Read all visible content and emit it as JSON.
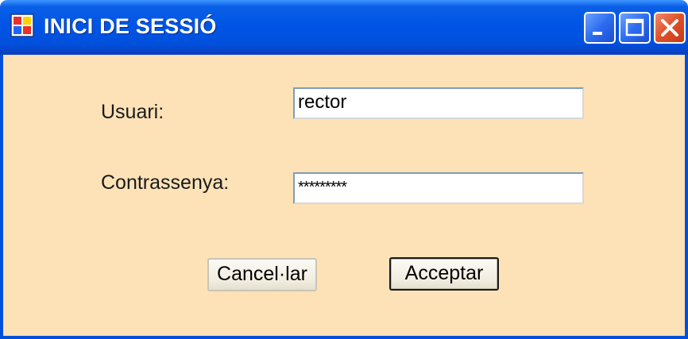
{
  "window": {
    "title": "INICI DE SESSIÓ",
    "icon": "windows-app-icon",
    "controls": [
      "minimize-icon",
      "maximize-icon",
      "close-icon"
    ]
  },
  "form": {
    "user_label": "Usuari:",
    "user_value": "rector",
    "password_label": "Contrassenya:",
    "password_value": "*********"
  },
  "buttons": {
    "cancel_label": "Cancel·lar",
    "accept_label": "Acceptar"
  },
  "colors": {
    "client_background": "#fde2b8",
    "titlebar": "#0055e5",
    "close_button": "#e0502a"
  }
}
